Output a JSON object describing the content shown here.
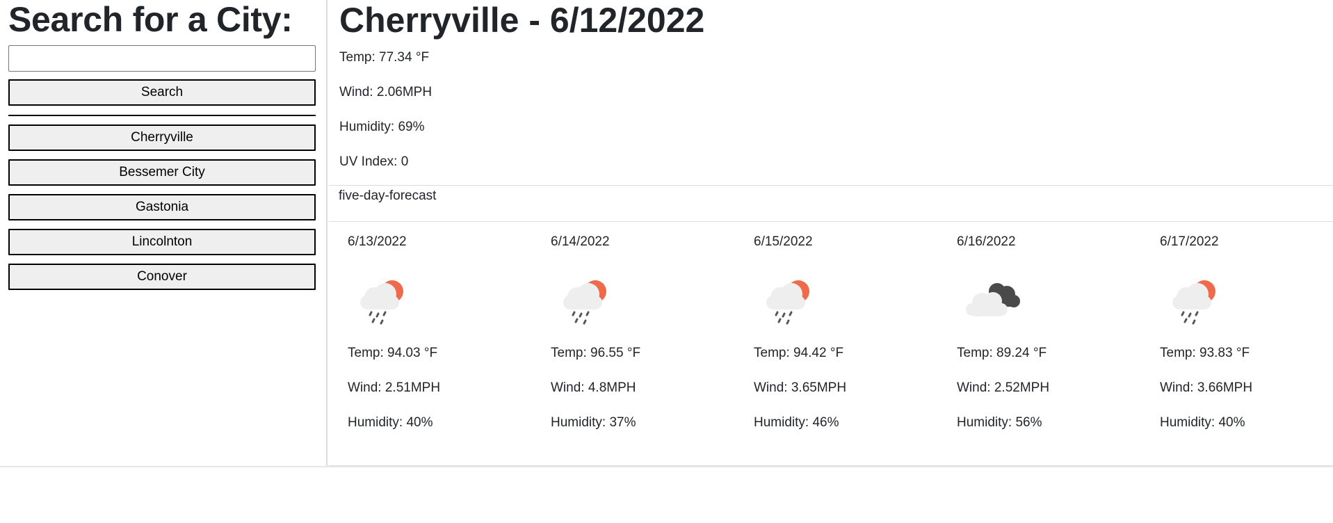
{
  "sidebar": {
    "title": "Search for a City:",
    "search": {
      "value": "",
      "button_label": "Search"
    },
    "history": [
      {
        "label": "Cherryville"
      },
      {
        "label": "Bessemer City"
      },
      {
        "label": "Gastonia"
      },
      {
        "label": "Lincolnton"
      },
      {
        "label": "Conover"
      }
    ]
  },
  "current": {
    "title": "Cherryville - 6/12/2022",
    "temp": "Temp: 77.34 °F",
    "wind": "Wind: 2.06MPH",
    "humidity": "Humidity: 69%",
    "uv": "UV Index: 0"
  },
  "forecast": {
    "header": "five-day-forecast",
    "days": [
      {
        "date": "6/13/2022",
        "icon": "rain-sun-icon",
        "temp": "Temp: 94.03 °F",
        "wind": "Wind: 2.51MPH",
        "humidity": "Humidity: 40%"
      },
      {
        "date": "6/14/2022",
        "icon": "rain-sun-icon",
        "temp": "Temp: 96.55 °F",
        "wind": "Wind: 4.8MPH",
        "humidity": "Humidity: 37%"
      },
      {
        "date": "6/15/2022",
        "icon": "rain-sun-icon",
        "temp": "Temp: 94.42 °F",
        "wind": "Wind: 3.65MPH",
        "humidity": "Humidity: 46%"
      },
      {
        "date": "6/16/2022",
        "icon": "broken-clouds-icon",
        "temp": "Temp: 89.24 °F",
        "wind": "Wind: 2.52MPH",
        "humidity": "Humidity: 56%"
      },
      {
        "date": "6/17/2022",
        "icon": "rain-sun-icon",
        "temp": "Temp: 93.83 °F",
        "wind": "Wind: 3.66MPH",
        "humidity": "Humidity: 40%"
      }
    ]
  },
  "colors": {
    "sun": "#ee6a4a",
    "cloud_light": "#eeeeee",
    "cloud_dark": "#4a4a4a",
    "rain": "#555555",
    "button_bg": "#efefef",
    "divider": "#dcdcdc"
  }
}
